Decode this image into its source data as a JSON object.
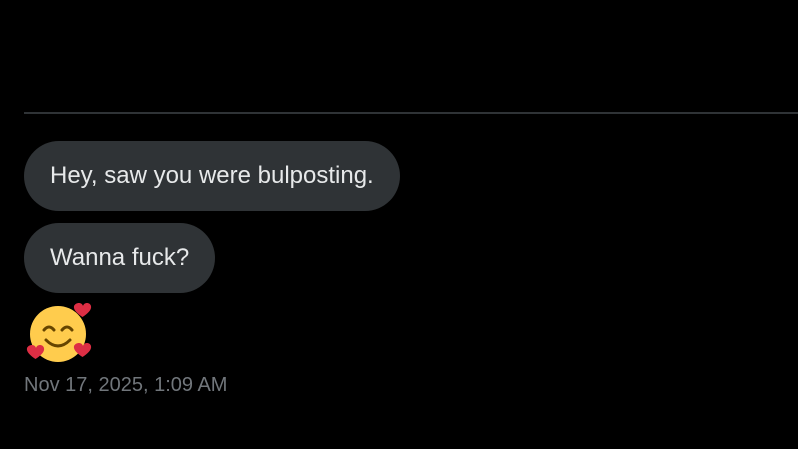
{
  "conversation": {
    "messages": [
      {
        "text": "Hey, saw you were bulposting."
      },
      {
        "text": "Wanna fuck?"
      }
    ],
    "reaction": {
      "icon": "smiling-face-with-hearts-icon"
    },
    "timestamp": "Nov 17, 2025, 1:09 AM"
  },
  "colors": {
    "background": "#000000",
    "bubble": "#2f3336",
    "bubble_text": "#e7e9ea",
    "timestamp_text": "#71767b",
    "divider": "#2f3336"
  }
}
